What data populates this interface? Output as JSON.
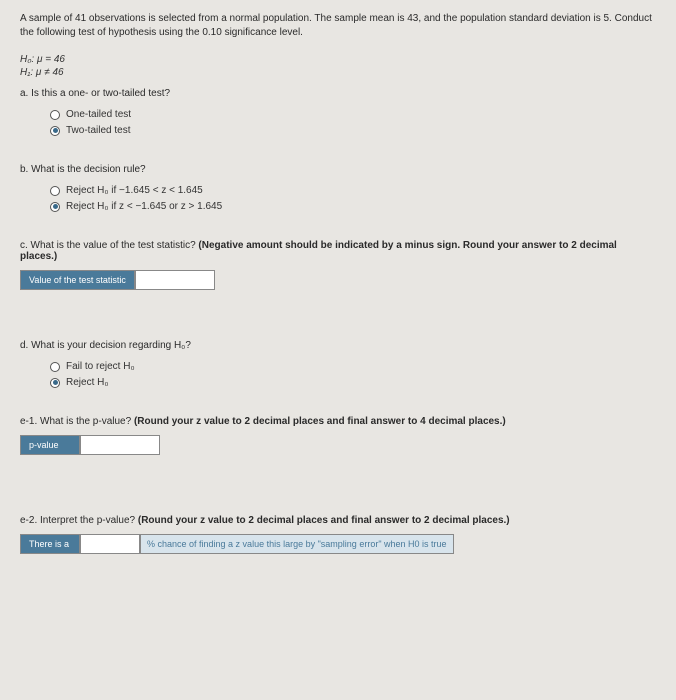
{
  "intro": "A sample of 41 observations is selected from a normal population. The sample mean is 43, and the population standard deviation is 5. Conduct the following test of hypothesis using the 0.10 significance level.",
  "hypotheses": {
    "h0": "H₀: μ = 46",
    "h1": "H₁: μ ≠ 46"
  },
  "a": {
    "question": "a. Is this a one- or two-tailed test?",
    "opt1": "One-tailed test",
    "opt2": "Two-tailed test"
  },
  "b": {
    "question": "b. What is the decision rule?",
    "opt1": "Reject H₀ if −1.645 < z < 1.645",
    "opt2": "Reject H₀ if z < −1.645 or z > 1.645"
  },
  "c": {
    "question": "c. What is the value of the test statistic? ",
    "instruction": "(Negative amount should be indicated by a minus sign. Round your answer to 2 decimal places.)",
    "label": "Value of the test statistic"
  },
  "d": {
    "question": "d. What is your decision regarding H₀?",
    "opt1": "Fail to reject H₀",
    "opt2": "Reject H₀"
  },
  "e1": {
    "question": "e-1. What is the p-value? ",
    "instruction": "(Round your z value to 2 decimal places and final answer to 4 decimal places.)",
    "label": "p-value"
  },
  "e2": {
    "question": "e-2. Interpret the p-value? ",
    "instruction": "(Round your z value to 2 decimal places and final answer to 2 decimal places.)",
    "label": "There is a",
    "trail": "% chance of finding a z value this large by \"sampling error\" when H0 is true"
  }
}
